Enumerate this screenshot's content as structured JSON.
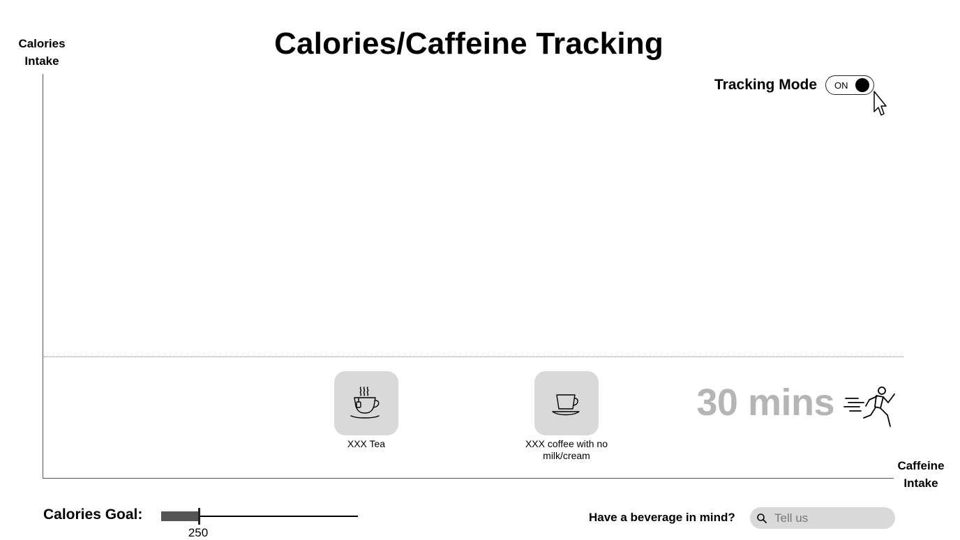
{
  "page": {
    "title": "Calories/Caffeine Tracking"
  },
  "axes": {
    "y_label": "Calories Intake",
    "x_label": "Caffeine Intake"
  },
  "tracking": {
    "label": "Tracking Mode",
    "toggle_text": "ON",
    "enabled": true
  },
  "beverages": [
    {
      "name": "XXX Tea",
      "icon": "tea-cup-icon"
    },
    {
      "name": "XXX coffee with no milk/cream",
      "icon": "coffee-cup-icon"
    }
  ],
  "activity": {
    "duration": "30 mins",
    "icon": "running-person-icon"
  },
  "calories_goal": {
    "label": "Calories Goal:",
    "value": "250",
    "fill_fraction": 0.19
  },
  "search": {
    "question": "Have a beverage in mind?",
    "placeholder": "Tell us",
    "icon": "search-icon"
  }
}
